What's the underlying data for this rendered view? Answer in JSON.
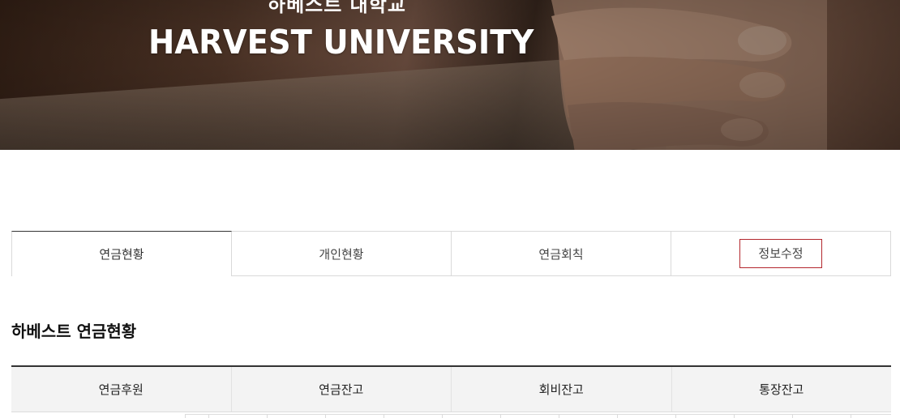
{
  "hero": {
    "title_kr": "하베스트 대학교",
    "title_en": "HARVEST UNIVERSITY"
  },
  "tabs": [
    {
      "label": "연금현황",
      "active": true
    },
    {
      "label": "개인현황",
      "active": false
    },
    {
      "label": "연금회칙",
      "active": false
    },
    {
      "label": "정보수정",
      "active": false,
      "highlighted": true
    }
  ],
  "section": {
    "title": "하베스트 연금현황"
  },
  "table": {
    "headers": [
      "연금후원",
      "연금잔고",
      "회비잔고",
      "통장잔고"
    ]
  },
  "colors": {
    "highlight_border": "#b3272d",
    "header_bg": "#f3f3f3",
    "border": "#d9d9d9"
  }
}
